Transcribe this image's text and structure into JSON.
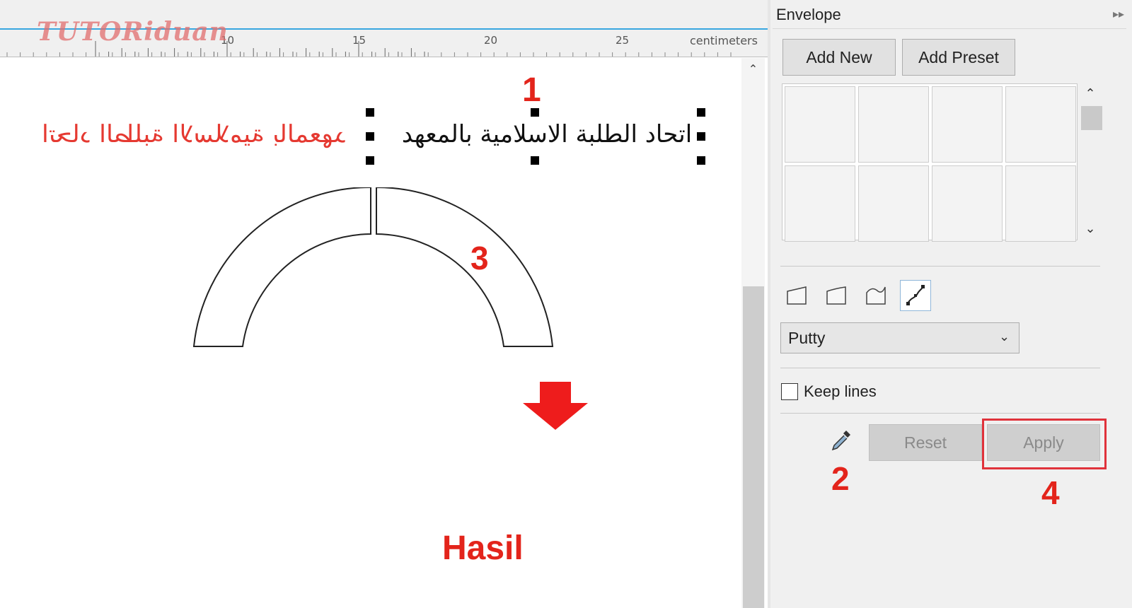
{
  "watermark": "TUTORiduan",
  "ruler": {
    "ticks": [
      "10",
      "15",
      "20",
      "25"
    ],
    "unit": "centimeters"
  },
  "canvas": {
    "selected_text": "اتحاد الطلبة الاسلامية بالمعهد",
    "mirrored_text": "اتحاد الطلبة الاسلامية بالمعهد",
    "result_text": "اتحاد الطلبة الاسلامية بالمعهد",
    "result_label": "Hasil",
    "steps": [
      "1",
      "2",
      "3",
      "4"
    ]
  },
  "panel": {
    "title": "Envelope",
    "add_new": "Add New",
    "add_preset": "Add Preset",
    "mode_select": "Putty",
    "keep_lines": "Keep lines",
    "keep_lines_checked": false,
    "reset": "Reset",
    "apply": "Apply"
  },
  "icons": {
    "collapse": "double-chevron-right-icon",
    "scroll_up": "chevron-up-icon",
    "scroll_down": "chevron-down-icon",
    "modes": [
      "straight-line-mode-icon",
      "single-arc-mode-icon",
      "double-arc-mode-icon",
      "unconstrained-mode-icon"
    ],
    "eyedropper": "eyedropper-icon",
    "result_arrow": "down-arrow-icon"
  },
  "colors": {
    "annotation": "#e3241b",
    "ruler_accent": "#38a7e0",
    "highlight": "#e0323b"
  }
}
